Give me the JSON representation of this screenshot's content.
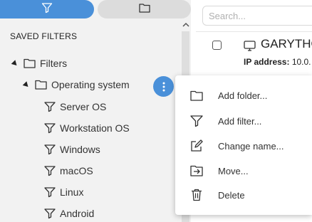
{
  "sidebar": {
    "saved_filters_title": "SAVED FILTERS",
    "tree": {
      "root_label": "Filters",
      "group_label": "Operating system",
      "items": [
        "Server OS",
        "Workstation OS",
        "Windows",
        "macOS",
        "Linux",
        "Android"
      ]
    }
  },
  "main": {
    "search_placeholder": "Search...",
    "device": {
      "name": "GARYTHO",
      "ip_label": "IP address:",
      "ip_value": "10.0."
    }
  },
  "context_menu": {
    "items": [
      {
        "label": "Add folder...",
        "icon": "folder-icon"
      },
      {
        "label": "Add filter...",
        "icon": "filter-icon"
      },
      {
        "label": "Change name...",
        "icon": "edit-icon"
      },
      {
        "label": "Move...",
        "icon": "move-icon"
      },
      {
        "label": "Delete",
        "icon": "trash-icon"
      }
    ]
  },
  "colors": {
    "accent": "#4a90d9",
    "panel_bg": "#f2f2f2"
  }
}
